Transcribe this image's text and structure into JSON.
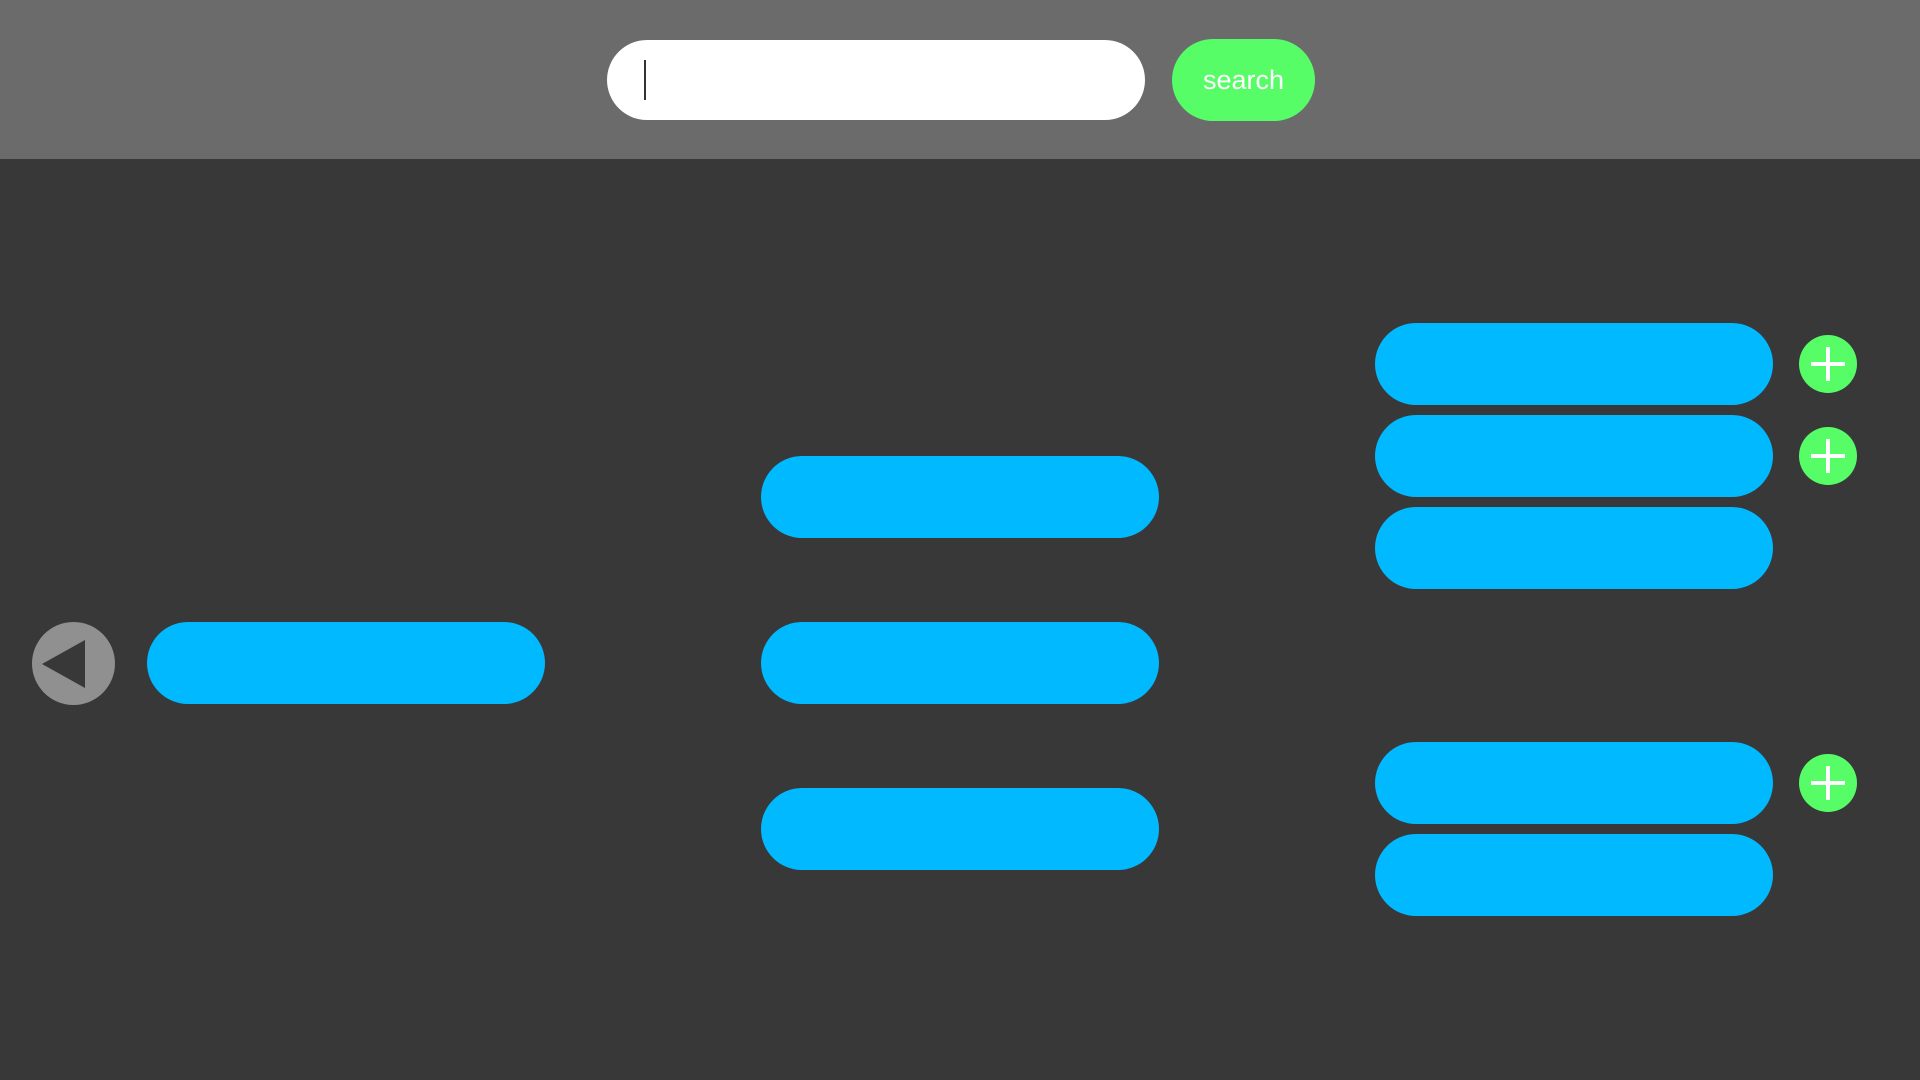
{
  "colors": {
    "background": "#383838",
    "topbar": "#6b6b6b",
    "accent_green": "#57fd66",
    "pill_blue": "#00b9ff",
    "back_gray": "#909090"
  },
  "header": {
    "search": {
      "value": "",
      "placeholder": ""
    },
    "search_button_label": "search"
  },
  "icons": {
    "back": "triangle-left-icon",
    "add": "plus-icon"
  }
}
